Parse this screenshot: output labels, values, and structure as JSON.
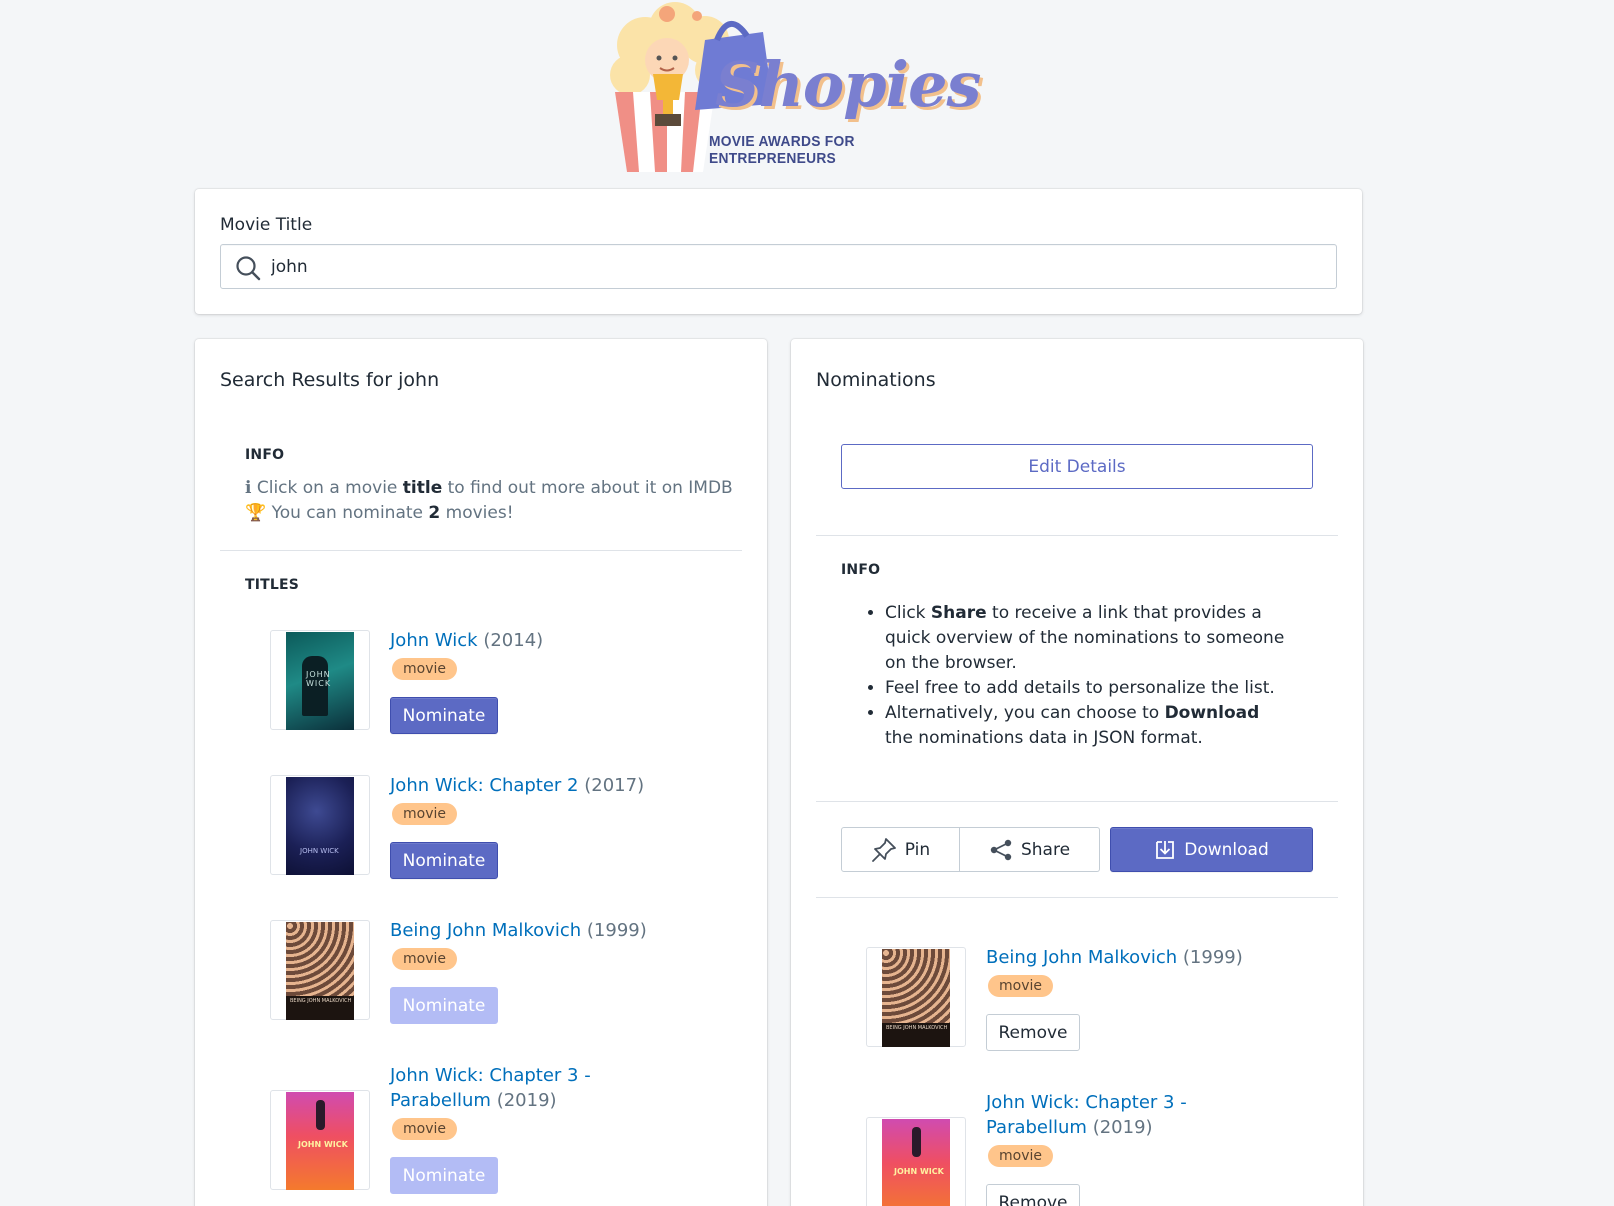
{
  "logo": {
    "word": "Shopies",
    "subtitle": "MOVIE AWARDS FOR ENTREPRENEURS"
  },
  "search": {
    "label": "Movie Title",
    "value": "john",
    "icon": "search-icon"
  },
  "results": {
    "title": "Search Results for john",
    "info_heading": "INFO",
    "info_line1_prefix": "ℹ Click on a movie ",
    "info_line1_bold": "title",
    "info_line1_suffix": " to find out more about it on IMDB",
    "info_line2_prefix": "🏆 You can nominate ",
    "info_line2_bold": "2",
    "info_line2_suffix": " movies!",
    "titles_heading": "TITLES",
    "items": [
      {
        "title": "John Wick",
        "year": "(2014)",
        "type": "movie",
        "button": "Nominate",
        "disabled": false
      },
      {
        "title": "John Wick: Chapter 2",
        "year": "(2017)",
        "type": "movie",
        "button": "Nominate",
        "disabled": false
      },
      {
        "title": "Being John Malkovich",
        "year": "(1999)",
        "type": "movie",
        "button": "Nominate",
        "disabled": true
      },
      {
        "title": "John Wick: Chapter 3 - Parabellum",
        "year": "(2019)",
        "type": "movie",
        "button": "Nominate",
        "disabled": true
      }
    ]
  },
  "nominations": {
    "title": "Nominations",
    "edit_button": "Edit Details",
    "info_heading": "INFO",
    "bullets": [
      {
        "pre": "Click ",
        "bold": "Share",
        "post": " to receive a link that provides a quick overview of the nominations to someone on the browser."
      },
      {
        "pre": "Feel free to add details to personalize the list.",
        "bold": "",
        "post": ""
      },
      {
        "pre": "Alternatively, you can choose to ",
        "bold": "Download",
        "post": " the nominations data in JSON format."
      }
    ],
    "pin_button": "Pin",
    "share_button": "Share",
    "download_button": "Download",
    "items": [
      {
        "title": "Being John Malkovich",
        "year": "(1999)",
        "type": "movie",
        "button": "Remove"
      },
      {
        "title": "John Wick: Chapter 3 - Parabellum",
        "year": "(2019)",
        "type": "movie",
        "button": "Remove"
      }
    ]
  },
  "colors": {
    "primary": "#5c6ac4",
    "primary_disabled": "#b3bcf5",
    "link": "#006fbb",
    "badge": "#ffc58b",
    "background": "#f4f6f8"
  }
}
